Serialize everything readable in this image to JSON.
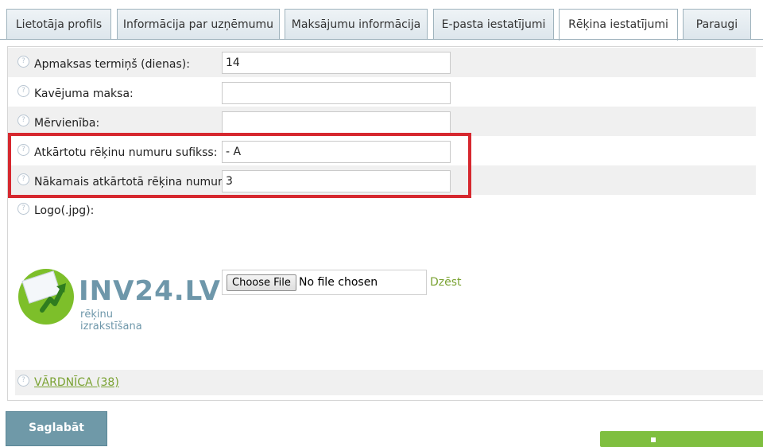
{
  "tabs": [
    {
      "label": "Lietotāja profils"
    },
    {
      "label": "Informācija par uzņēmumu"
    },
    {
      "label": "Maksājumu informācija"
    },
    {
      "label": "E-pasta iestatījumi"
    },
    {
      "label": "Rēķina iestatījumi",
      "active": true
    },
    {
      "label": "Paraugi"
    }
  ],
  "settings": {
    "payment_term": {
      "label": "Apmaksas termiņš (dienas):",
      "value": "14"
    },
    "late_fee": {
      "label": "Kavējuma maksa:",
      "value": ""
    },
    "unit": {
      "label": "Mērvienība:",
      "value": ""
    },
    "recurring_suffix": {
      "label": "Atkārtotu rēķinu numuru sufikss:",
      "value": "- A"
    },
    "next_recurring_number": {
      "label": "Nākamais atkārtotā rēķina numurs:",
      "value": "3"
    },
    "logo": {
      "label": "Logo(.jpg):"
    }
  },
  "logo": {
    "brand": "INV24.LV",
    "tagline": "rēķinu izrakstīšana"
  },
  "file_input": {
    "button_label": "Choose File",
    "status": "No file chosen"
  },
  "delete_link": "Dzēst",
  "dictionary_link": "VĀRDNĪCA (38)",
  "save_button": "Saglabāt",
  "help_icon_glyph": "?",
  "colors": {
    "accent_green": "#7aa232",
    "save_button": "#6f99a8",
    "highlight_border": "#d6282f"
  }
}
